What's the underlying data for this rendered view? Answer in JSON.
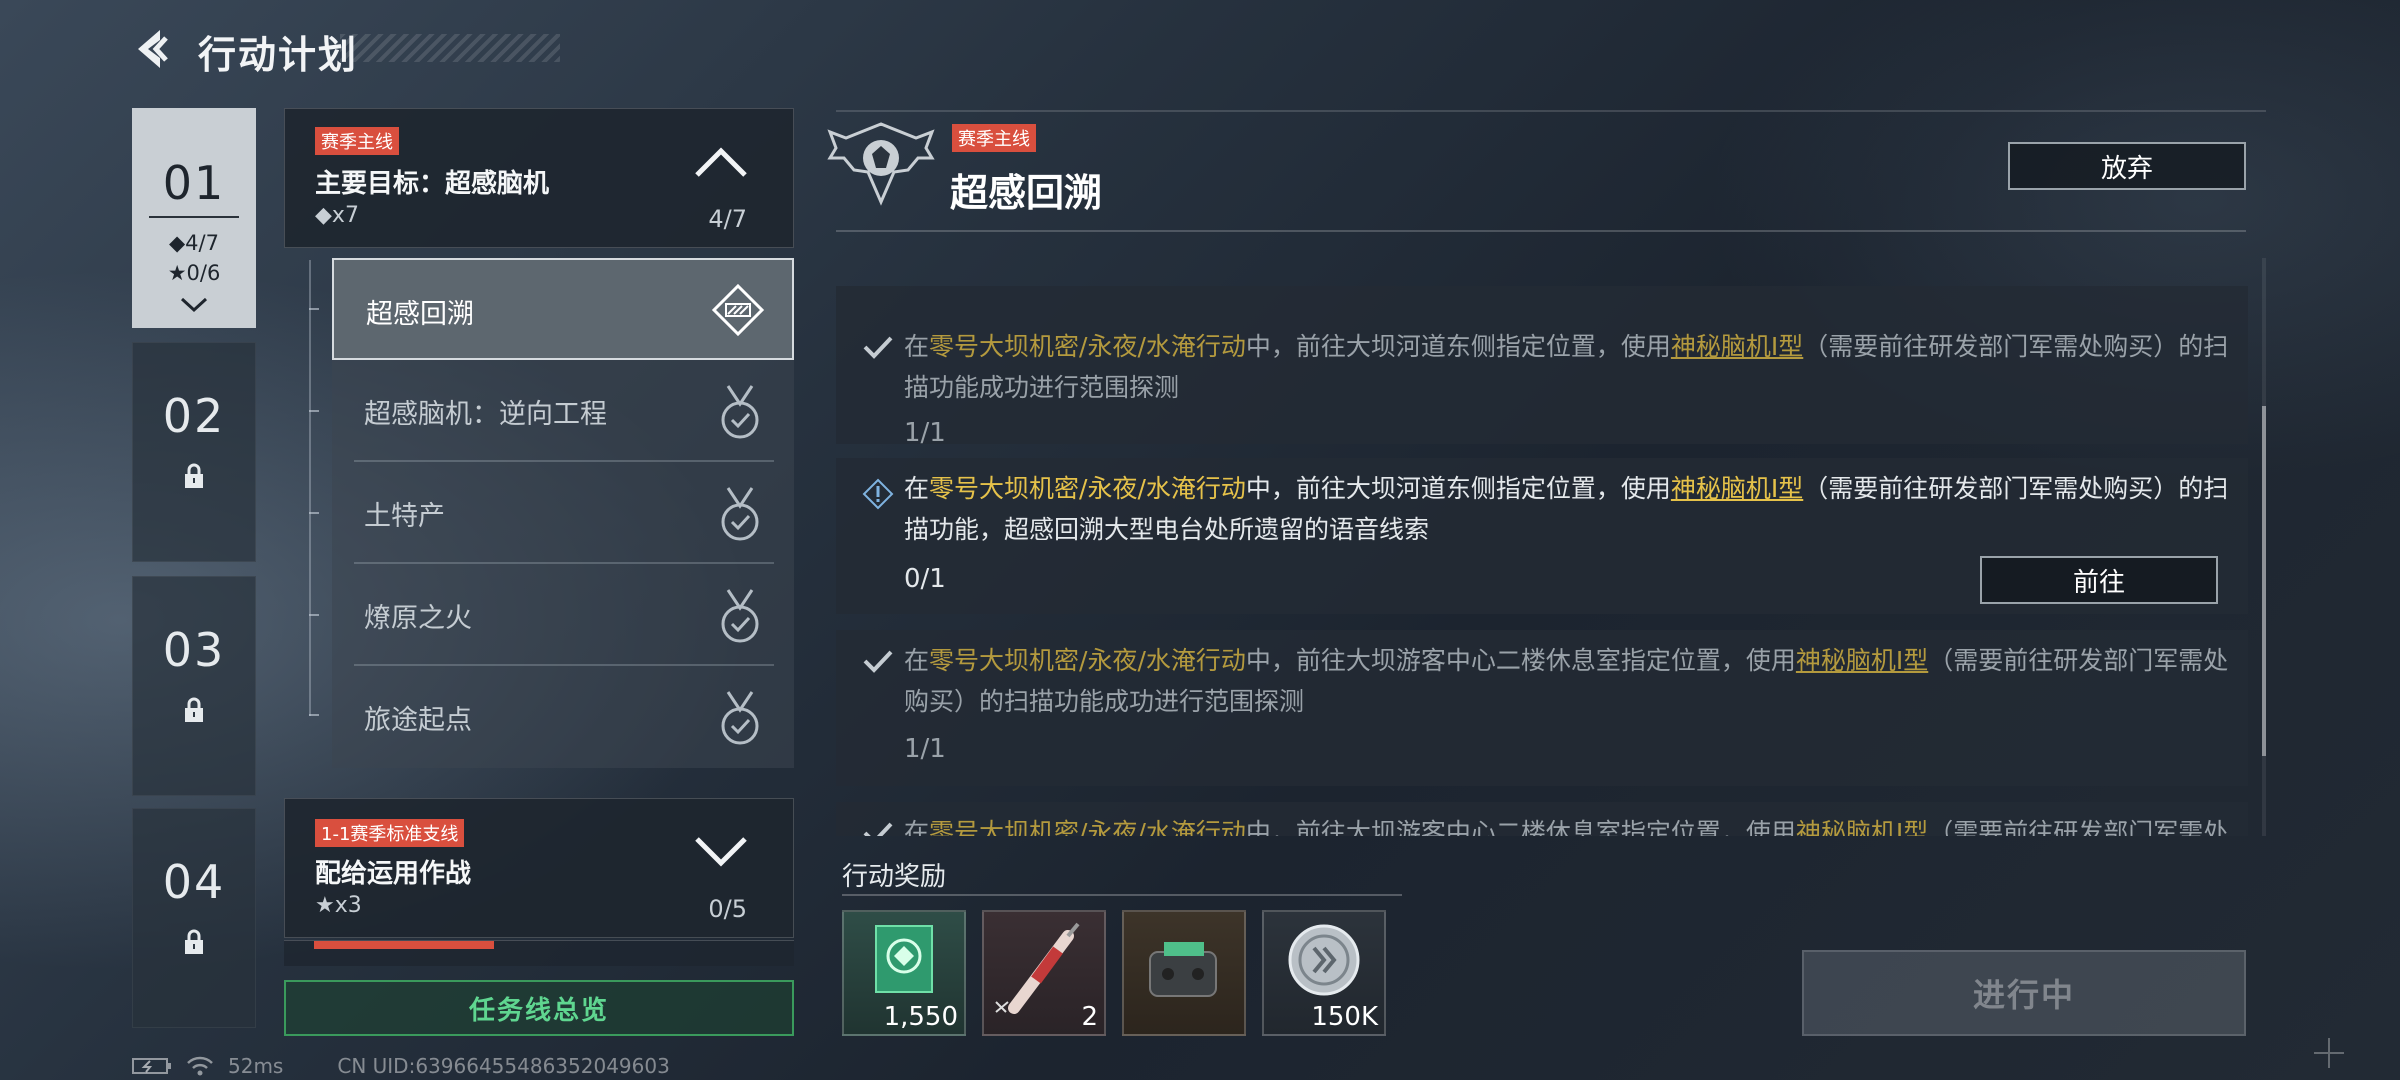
{
  "header": {
    "title": "行动计划",
    "back_icon": "back-arrow-icon"
  },
  "chapters": [
    {
      "num": "01",
      "diamond_prog": "◆4/7",
      "star_prog": "★0/6",
      "state": "active"
    },
    {
      "num": "02",
      "state": "locked"
    },
    {
      "num": "03",
      "state": "locked"
    },
    {
      "num": "04",
      "state": "locked"
    }
  ],
  "main_mission": {
    "tag": "赛季主线",
    "title": "主要目标：超感脑机",
    "sub": "◆x7",
    "count": "4/7"
  },
  "sub_missions": [
    {
      "label": "超感回溯",
      "state": "active"
    },
    {
      "label": "超感脑机：逆向工程",
      "state": "done"
    },
    {
      "label": "土特产",
      "state": "done"
    },
    {
      "label": "燎原之火",
      "state": "done"
    },
    {
      "label": "旅途起点",
      "state": "done"
    }
  ],
  "branch_mission": {
    "tag": "1-1赛季标准支线",
    "title": "配给运用作战",
    "sub": "★x3",
    "count": "0/5"
  },
  "overview_button": "任务线总览",
  "detail": {
    "tag": "赛季主线",
    "title": "超感回溯",
    "abandon": "放弃",
    "tasks": [
      {
        "state": "done",
        "t1": "在",
        "loc": "零号大坝机密/永夜/水淹行动",
        "t2": "中，前往大坝河道东侧指定位置，使用",
        "item": "神秘脑机Ⅰ型",
        "t3": "（需要前往研发部门军需处购买）的扫描功能成功进行范围探测",
        "progress": "1/1"
      },
      {
        "state": "pending",
        "t1": "在",
        "loc": "零号大坝机密/永夜/水淹行动",
        "t2": "中，前往大坝河道东侧指定位置，使用",
        "item": "神秘脑机Ⅰ型",
        "t3": "（需要前往研发部门军需处购买）的扫描功能，超感回溯大型电台处所遗留的语音线索",
        "progress": "0/1",
        "goto": "前往"
      },
      {
        "state": "done",
        "t1": "在",
        "loc": "零号大坝机密/永夜/水淹行动",
        "t2": "中，前往大坝游客中心二楼休息室指定位置，使用",
        "item": "神秘脑机Ⅰ型",
        "t3": "（需要前往研发部门军需处购买）的扫描功能成功进行范围探测",
        "progress": "1/1"
      },
      {
        "state": "done",
        "t1": "在",
        "loc": "零号大坝机密/永夜/水淹行动",
        "t2": "中，前往大坝游客中心二楼休息室指定位置，使用",
        "item": "神秘脑机Ⅰ型",
        "t3": "（需要前往研发部门军需处购买）",
        "progress": ""
      }
    ]
  },
  "rewards": {
    "title": "行动奖励",
    "items": [
      {
        "icon": "green-emblem-box-icon",
        "qty": "1,550"
      },
      {
        "icon": "injector-icon",
        "qty": "2"
      },
      {
        "icon": "gadget-device-icon",
        "qty": ""
      },
      {
        "icon": "silver-coin-icon",
        "qty": "150K"
      }
    ]
  },
  "status_button": "进行中",
  "status_bar": {
    "ping": "52ms",
    "uid": "CN UID:6396645548635204960​3"
  },
  "colors": {
    "accent_red": "#d94f3e",
    "highlight_yellow": "#e6c24a",
    "green": "#5fd690"
  }
}
